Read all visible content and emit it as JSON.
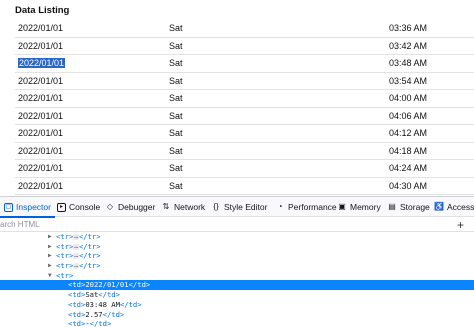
{
  "page": {
    "title": "Data Listing",
    "rows": [
      {
        "date": "2022/01/01",
        "day": "Sat",
        "time": "03:36 AM",
        "selected": false
      },
      {
        "date": "2022/01/01",
        "day": "Sat",
        "time": "03:42 AM",
        "selected": false
      },
      {
        "date": "2022/01/01",
        "day": "Sat",
        "time": "03:48 AM",
        "selected": true
      },
      {
        "date": "2022/01/01",
        "day": "Sat",
        "time": "03:54 AM",
        "selected": false
      },
      {
        "date": "2022/01/01",
        "day": "Sat",
        "time": "04:00 AM",
        "selected": false
      },
      {
        "date": "2022/01/01",
        "day": "Sat",
        "time": "04:06 AM",
        "selected": false
      },
      {
        "date": "2022/01/01",
        "day": "Sat",
        "time": "04:12 AM",
        "selected": false
      },
      {
        "date": "2022/01/01",
        "day": "Sat",
        "time": "04:18 AM",
        "selected": false
      },
      {
        "date": "2022/01/01",
        "day": "Sat",
        "time": "04:24 AM",
        "selected": false
      },
      {
        "date": "2022/01/01",
        "day": "Sat",
        "time": "04:30 AM",
        "selected": false
      }
    ]
  },
  "devtools": {
    "tabs": [
      {
        "label": "Inspector",
        "icon": "inspector-icon",
        "glyph": "▢",
        "active": true
      },
      {
        "label": "Console",
        "icon": "console-icon",
        "glyph": "▸",
        "active": false
      },
      {
        "label": "Debugger",
        "icon": "debugger-icon",
        "glyph": "◇",
        "active": false
      },
      {
        "label": "Network",
        "icon": "network-icon",
        "glyph": "⇅",
        "active": false
      },
      {
        "label": "Style Editor",
        "icon": "style-editor-icon",
        "glyph": "{}",
        "active": false
      },
      {
        "label": "Performance",
        "icon": "performance-icon",
        "glyph": "◔",
        "active": false
      },
      {
        "label": "Memory",
        "icon": "memory-icon",
        "glyph": "▣",
        "active": false
      },
      {
        "label": "Storage",
        "icon": "storage-icon",
        "glyph": "▤",
        "active": false
      },
      {
        "label": "Accessibili",
        "icon": "accessibility-icon",
        "glyph": "♿",
        "active": false
      }
    ],
    "search": {
      "placeholder": "arch HTML",
      "add_glyph": "+"
    },
    "tree": [
      {
        "twisty": "▶",
        "indent": 50,
        "open": "<tr>",
        "collapsed": true,
        "close": "</tr>",
        "selected": false
      },
      {
        "twisty": "▶",
        "indent": 50,
        "open": "<tr>",
        "collapsed": true,
        "close": "</tr>",
        "selected": false
      },
      {
        "twisty": "▶",
        "indent": 50,
        "open": "<tr>",
        "collapsed": true,
        "close": "</tr>",
        "selected": false
      },
      {
        "twisty": "▶",
        "indent": 50,
        "open": "<tr>",
        "collapsed": true,
        "close": "</tr>",
        "selected": false
      },
      {
        "twisty": "▼",
        "indent": 50,
        "open": "<tr>",
        "collapsed": false,
        "close": "",
        "selected": false
      },
      {
        "twisty": "",
        "indent": 62,
        "open": "<td>",
        "text": "2022/01/01",
        "close": "</td>",
        "selected": true
      },
      {
        "twisty": "",
        "indent": 62,
        "open": "<td>",
        "text": "Sat",
        "close": "</td>",
        "selected": false
      },
      {
        "twisty": "",
        "indent": 62,
        "open": "<td>",
        "text": "03:48 AM",
        "close": "</td>",
        "selected": false
      },
      {
        "twisty": "",
        "indent": 62,
        "open": "<td>",
        "text": "2.57",
        "close": "</td>",
        "selected": false
      },
      {
        "twisty": "",
        "indent": 62,
        "open": "<td>",
        "text": "-",
        "close": "</td>",
        "selected": false
      }
    ],
    "collapsed_badge": "…"
  },
  "colors": {
    "accent": "#0061e0",
    "selection": "#0a84ff",
    "text_selection": "#2a66c8"
  }
}
